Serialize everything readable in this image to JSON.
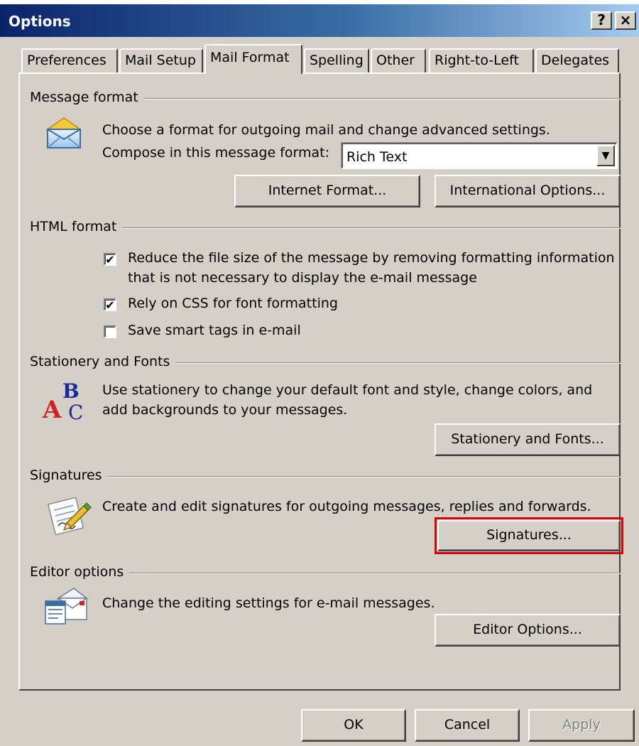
{
  "window": {
    "title": "Options",
    "help_label": "?",
    "close_label": "×"
  },
  "tabs": [
    {
      "label": "Preferences",
      "active": false
    },
    {
      "label": "Mail Setup",
      "active": false
    },
    {
      "label": "Mail Format",
      "active": true
    },
    {
      "label": "Spelling",
      "active": false
    },
    {
      "label": "Other",
      "active": false
    },
    {
      "label": "Right-to-Left",
      "active": false
    },
    {
      "label": "Delegates",
      "active": false
    }
  ],
  "message_format": {
    "heading": "Message format",
    "description": "Choose a format for outgoing mail and change advanced settings.",
    "compose_label": "Compose in this message format:",
    "compose_value": "Rich Text",
    "internet_format_button": "Internet Format...",
    "international_options_button": "International Options...",
    "icon": "envelope-icon"
  },
  "html_format": {
    "heading": "HTML format",
    "reduce_size_line1": "Reduce the file size of the message by removing formatting information",
    "reduce_size_line2": "that is not necessary to display the e-mail message",
    "reduce_size_checked": true,
    "css_label": "Rely on CSS for font formatting",
    "css_checked": true,
    "smart_tags_label": "Save smart tags in e-mail",
    "smart_tags_checked": false,
    "check_mark": "✔"
  },
  "stationery": {
    "heading": "Stationery and Fonts",
    "line1": "Use stationery to change your default font and style, change colors, and",
    "line2": "add backgrounds to your messages.",
    "button": "Stationery and Fonts...",
    "icon_letters": {
      "b": "B",
      "a": "A",
      "c": "C"
    }
  },
  "signatures": {
    "heading": "Signatures",
    "description": "Create and edit signatures for outgoing messages, replies and forwards.",
    "button": "Signatures...",
    "highlight_color": "#e00000",
    "icon": "signature-pen-icon"
  },
  "editor": {
    "heading": "Editor options",
    "description": "Change the editing settings for e-mail messages.",
    "button": "Editor Options...",
    "icon": "editor-document-icon"
  },
  "footer": {
    "ok": "OK",
    "cancel": "Cancel",
    "apply": "Apply",
    "apply_enabled": false
  }
}
